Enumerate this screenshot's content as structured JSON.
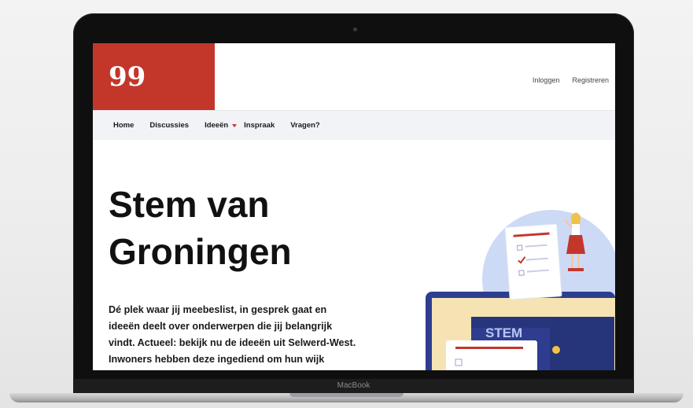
{
  "site": {
    "logo": {
      "glyph": "99",
      "color": "#c3372b"
    },
    "auth": {
      "login": "Inloggen",
      "register": "Registreren"
    },
    "nav": [
      {
        "label": "Home",
        "has_dropdown": false
      },
      {
        "label": "Discussies",
        "has_dropdown": false
      },
      {
        "label": "Ideeën",
        "has_dropdown": true
      },
      {
        "label": "Inspraak",
        "has_dropdown": false
      },
      {
        "label": "Vragen?",
        "has_dropdown": false
      }
    ],
    "hero": {
      "title_line1": "Stem van",
      "title_line2": "Groningen",
      "desc_lines": [
        "Dé plek waar jij meebeslist, in gesprek gaat en",
        "ideeën deelt over onderwerpen die jij belangrijk",
        "vindt. Actueel: bekijk nu de ideeën uit Selwerd-West.",
        "Inwoners hebben deze ingediend om hun wijk"
      ],
      "illustration": {
        "ballot_box_label": "STEM"
      }
    }
  },
  "device": {
    "brand": "MacBook"
  },
  "colors": {
    "accent": "#c3372b",
    "nav_bg": "#f1f3f7",
    "illustration_navy": "#2e3d8f",
    "illustration_sky": "#cddaf5"
  }
}
